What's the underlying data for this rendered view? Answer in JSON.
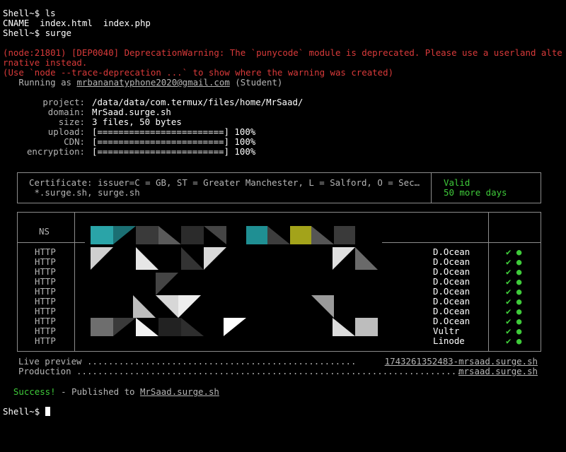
{
  "terminal": {
    "prompt": "Shell~$",
    "cmd_ls": "ls",
    "ls_output": "CNAME  index.html  index.php",
    "cmd_surge": "surge",
    "warning_line1": "(node:21801) [DEP0040] DeprecationWarning: The `punycode` module is deprecated. Please use a userland alte",
    "warning_line2": "rnative instead.",
    "warning_line3": "(Use `node --trace-deprecation ...` to show where the warning was created)",
    "running_prefix": "Running as ",
    "running_email": "mrbananatyphone2020@gmail.com",
    "running_suffix": " (Student)"
  },
  "deploy": {
    "project_label": "project:",
    "project_value": "/data/data/com.termux/files/home/MrSaad/",
    "domain_label": "domain:",
    "domain_value": "MrSaad.surge.sh",
    "size_label": "size:",
    "size_value": "3 files, 50 bytes",
    "upload_label": "upload:",
    "upload_value": "[========================] 100%",
    "cdn_label": "CDN:",
    "cdn_value": "[========================] 100%",
    "encryption_label": "encryption:",
    "encryption_value": "[========================] 100%"
  },
  "certificate": {
    "line1": "Certificate: issuer=C = GB, ST = Greater Manchester, L = Salford, O = Sec…",
    "line2": "*.surge.sh, surge.sh",
    "status": "Valid",
    "remaining": "50 more days"
  },
  "ns_table": {
    "header": "NS",
    "rows": [
      {
        "type": "HTTP",
        "provider": "D.Ocean",
        "ok": "✔ ●"
      },
      {
        "type": "HTTP",
        "provider": "D.Ocean",
        "ok": "✔ ●"
      },
      {
        "type": "HTTP",
        "provider": "D.Ocean",
        "ok": "✔ ●"
      },
      {
        "type": "HTTP",
        "provider": "D.Ocean",
        "ok": "✔ ●"
      },
      {
        "type": "HTTP",
        "provider": "D.Ocean",
        "ok": "✔ ●"
      },
      {
        "type": "HTTP",
        "provider": "D.Ocean",
        "ok": "✔ ●"
      },
      {
        "type": "HTTP",
        "provider": "D.Ocean",
        "ok": "✔ ●"
      },
      {
        "type": "HTTP",
        "provider": "D.Ocean",
        "ok": "✔ ●"
      },
      {
        "type": "HTTP",
        "provider": "Vultr",
        "ok": "✔ ●"
      },
      {
        "type": "HTTP",
        "provider": "Linode",
        "ok": "✔ ●"
      }
    ]
  },
  "links": {
    "preview_label": "Live preview ...................................................",
    "preview_url": "1743261352483-mrsaad.surge.sh",
    "production_label": "Production .........................................................................",
    "production_url": "mrsaad.surge.sh"
  },
  "result": {
    "success": "Success!",
    "published_prefix": " - Published to ",
    "published_url": "MrSaad.surge.sh"
  },
  "colors": {
    "background": "#000000",
    "error": "#d93a3a",
    "success": "#3fcb3a",
    "border": "#8c8c8c"
  }
}
